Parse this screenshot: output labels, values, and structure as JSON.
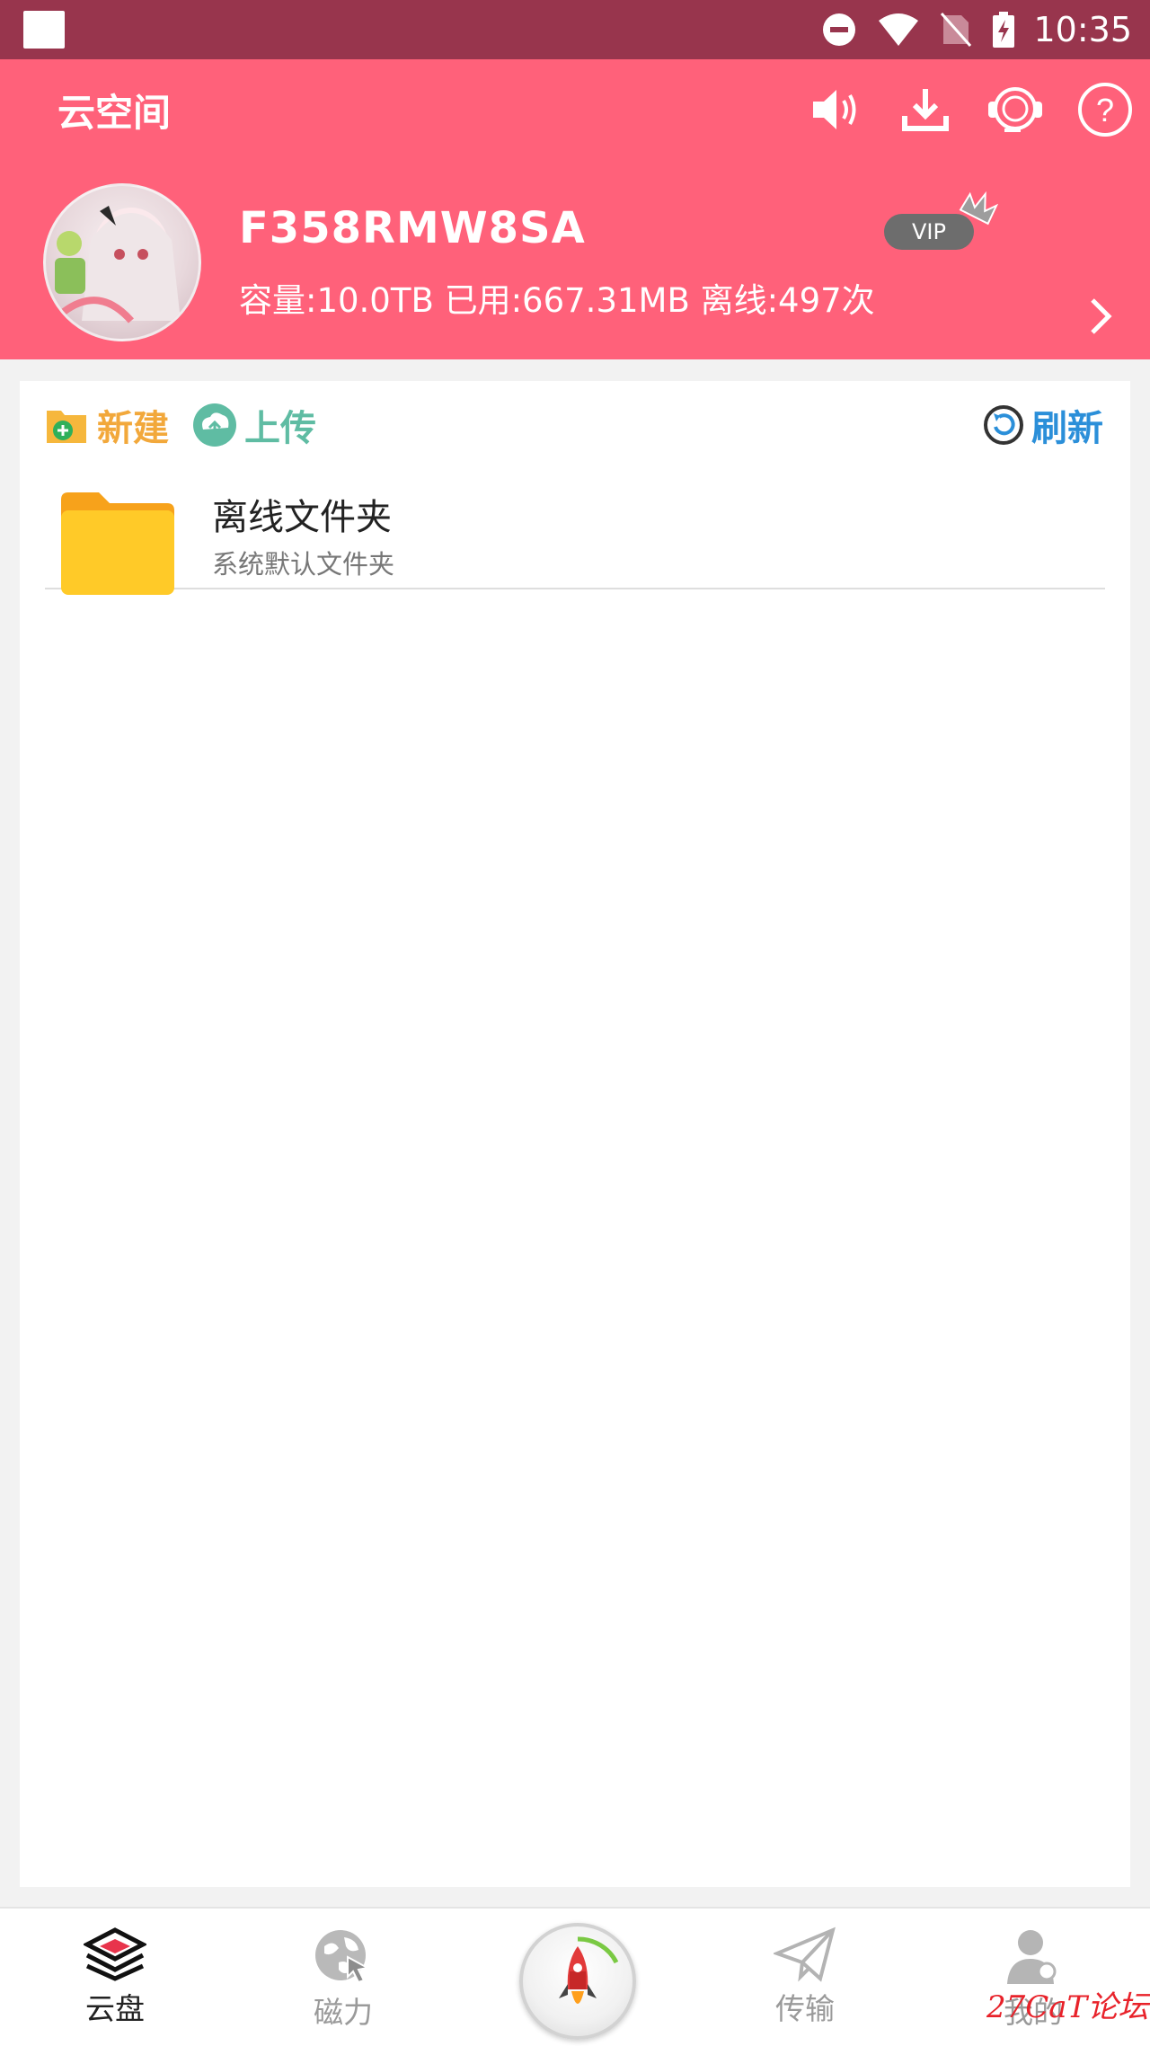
{
  "status_bar": {
    "time": "10:35",
    "icons": [
      "dnd-icon",
      "wifi-icon",
      "no-sim-icon",
      "battery-charging-icon"
    ]
  },
  "header": {
    "title": "云空间",
    "actions": [
      "speaker-icon",
      "download-icon",
      "headset-icon",
      "help-icon"
    ]
  },
  "account": {
    "username": "F358RMW8SA",
    "stats": "容量:10.0TB 已用:667.31MB 离线:497次",
    "vip_label": "VIP"
  },
  "toolbar": {
    "new_label": "新建",
    "upload_label": "上传",
    "refresh_label": "刷新"
  },
  "files": [
    {
      "name": "离线文件夹",
      "desc": "系统默认文件夹"
    }
  ],
  "nav": {
    "cloud": "云盘",
    "magnet": "磁力",
    "transfer": "传输",
    "mine": "我的"
  },
  "watermark": "27CaT论坛",
  "colors": {
    "header": "#ff617a",
    "statusbar": "#98354d",
    "new": "#f2a83b",
    "upload": "#5fbca3",
    "refresh": "#2b8fd9",
    "folder": "#ffca28"
  }
}
